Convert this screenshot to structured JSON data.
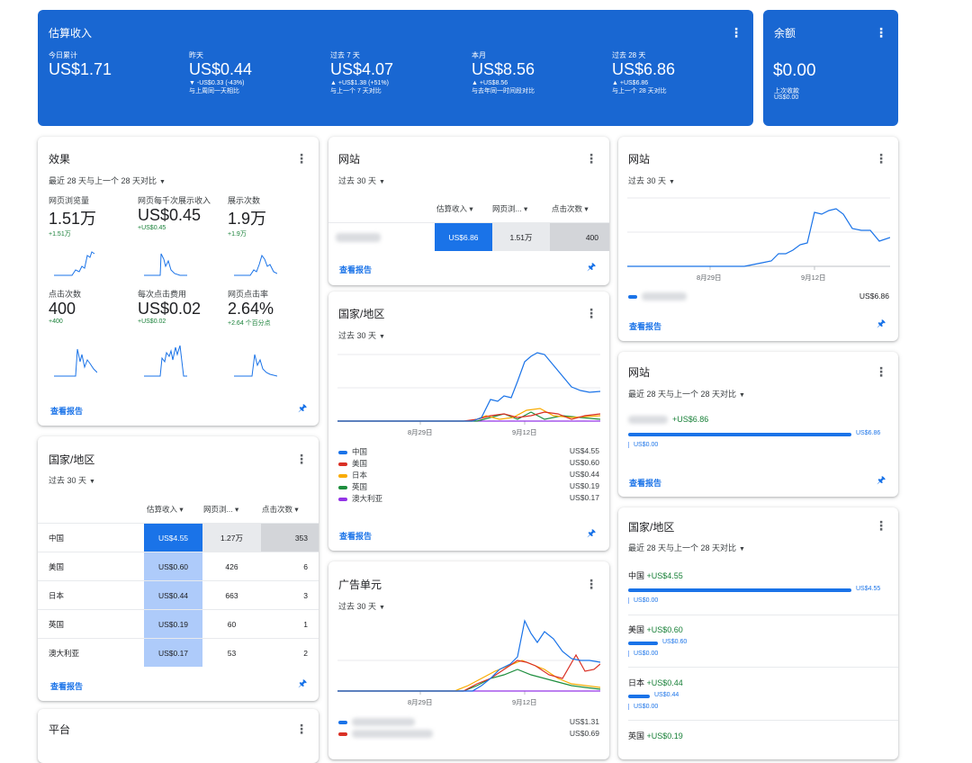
{
  "summary": {
    "title": "估算收入",
    "metrics": [
      {
        "label": "今日累计",
        "value": "US$1.71",
        "change": "",
        "compare": ""
      },
      {
        "label": "昨天",
        "value": "US$0.44",
        "change": "▼ -US$0.33 (-43%)",
        "compare": "与上周同一天相比"
      },
      {
        "label": "过去 7 天",
        "value": "US$4.07",
        "change": "▲ +US$1.38 (+51%)",
        "compare": "与上一个 7 天对比"
      },
      {
        "label": "本月",
        "value": "US$8.56",
        "change": "▲ +US$8.56",
        "compare": "与去年同一时间段对比"
      },
      {
        "label": "过去 28 天",
        "value": "US$6.86",
        "change": "▲ +US$6.86",
        "compare": "与上一个 28 天对比"
      }
    ]
  },
  "balance": {
    "title": "余额",
    "value": "$0.00",
    "last_label": "上次收款",
    "last_value": "US$0.00"
  },
  "performance": {
    "title": "效果",
    "range": "最近 28 天与上一个 28 天对比",
    "metrics": [
      {
        "label": "网页浏览量",
        "value": "1.51万",
        "delta": "+1.51万"
      },
      {
        "label": "网页每千次展示收入",
        "value": "US$0.45",
        "delta": "+US$0.45"
      },
      {
        "label": "展示次数",
        "value": "1.9万",
        "delta": "+1.9万"
      },
      {
        "label": "点击次数",
        "value": "400",
        "delta": "+400"
      },
      {
        "label": "每次点击费用",
        "value": "US$0.02",
        "delta": "+US$0.02"
      },
      {
        "label": "网页点击率",
        "value": "2.64%",
        "delta": "+2.64 个百分点"
      }
    ],
    "link": "查看报告"
  },
  "country_table": {
    "title": "国家/地区",
    "range": "过去 30 天",
    "headers": [
      "估算收入",
      "网页浏...",
      "点击次数"
    ],
    "rows": [
      {
        "name": "中国",
        "revenue": "US$4.55",
        "views": "1.27万",
        "clicks": "353"
      },
      {
        "name": "美国",
        "revenue": "US$0.60",
        "views": "426",
        "clicks": "6"
      },
      {
        "name": "日本",
        "revenue": "US$0.44",
        "views": "663",
        "clicks": "3"
      },
      {
        "name": "英国",
        "revenue": "US$0.19",
        "views": "60",
        "clicks": "1"
      },
      {
        "name": "澳大利亚",
        "revenue": "US$0.17",
        "views": "53",
        "clicks": "2"
      }
    ],
    "link": "查看报告"
  },
  "platform": {
    "title": "平台"
  },
  "sites_table": {
    "title": "网站",
    "range": "过去 30 天",
    "headers": [
      "估算收入",
      "网页浏...",
      "点击次数"
    ],
    "row": {
      "revenue": "US$6.86",
      "views": "1.51万",
      "clicks": "400"
    },
    "link": "查看报告"
  },
  "country_chart": {
    "title": "国家/地区",
    "range": "过去 30 天",
    "x_ticks": [
      "8月29日",
      "9月12日"
    ],
    "legend": [
      {
        "name": "中国",
        "value": "US$4.55",
        "color": "#1a73e8"
      },
      {
        "name": "美国",
        "value": "US$0.60",
        "color": "#d93025"
      },
      {
        "name": "日本",
        "value": "US$0.44",
        "color": "#f9ab00"
      },
      {
        "name": "英国",
        "value": "US$0.19",
        "color": "#1e8e3e"
      },
      {
        "name": "澳大利亚",
        "value": "US$0.17",
        "color": "#9334e6"
      }
    ],
    "link": "查看报告"
  },
  "adunit_chart": {
    "title": "广告单元",
    "range": "过去 30 天",
    "x_ticks": [
      "8月29日",
      "9月12日"
    ],
    "legend_values": [
      "US$1.31",
      "US$0.69"
    ]
  },
  "site_chart": {
    "title": "网站",
    "range": "过去 30 天",
    "x_ticks": [
      "8月29日",
      "9月12日"
    ],
    "legend_value": "US$6.86",
    "link": "查看报告"
  },
  "site_compare": {
    "title": "网站",
    "range": "最近 28 天与上一个 28 天对比",
    "delta": "+US$6.86",
    "current": "US$6.86",
    "previous": "US$0.00",
    "link": "查看报告"
  },
  "country_compare": {
    "title": "国家/地区",
    "range": "最近 28 天与上一个 28 天对比",
    "items": [
      {
        "name": "中国",
        "delta": "+US$4.55",
        "current": "US$4.55",
        "previous": "US$0.00",
        "fraction": 1.0
      },
      {
        "name": "美国",
        "delta": "+US$0.60",
        "current": "US$0.60",
        "previous": "US$0.00",
        "fraction": 0.13
      },
      {
        "name": "日本",
        "delta": "+US$0.44",
        "current": "US$0.44",
        "previous": "US$0.00",
        "fraction": 0.1
      },
      {
        "name": "英国",
        "delta": "+US$0.19",
        "current": "",
        "previous": "",
        "fraction": 0.04
      }
    ]
  }
}
